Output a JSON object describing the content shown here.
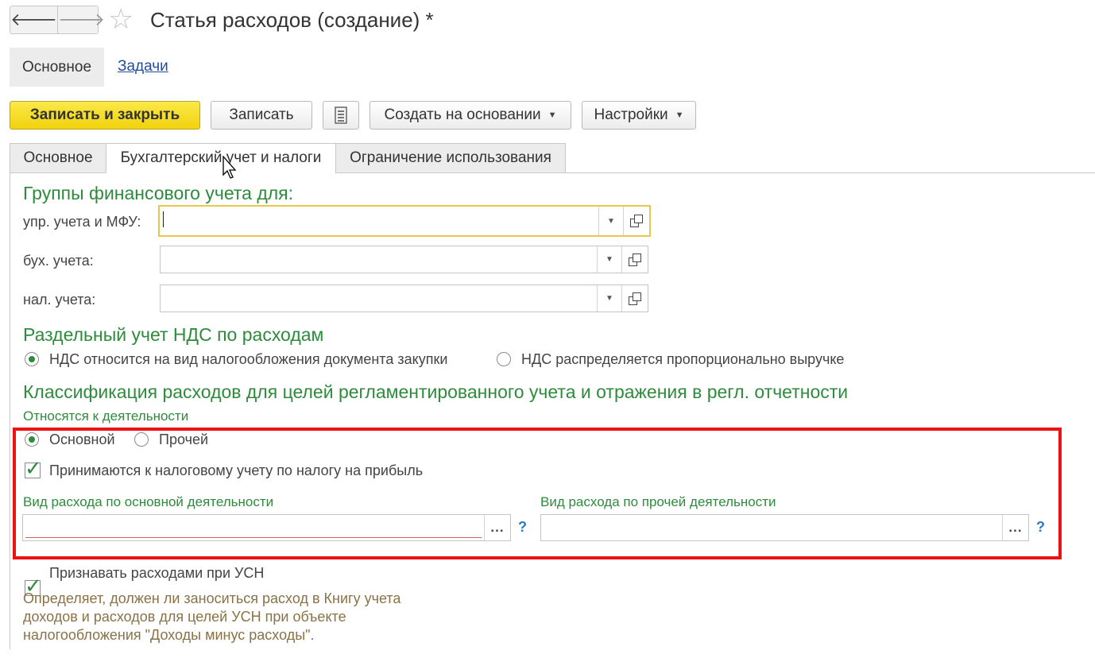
{
  "window": {
    "back_icon": "arrow-left-icon",
    "forward_icon": "arrow-right-icon",
    "favorite_icon": "star-icon",
    "title": "Статья расходов (создание) *"
  },
  "nav": {
    "main": "Основное",
    "tasks": "Задачи"
  },
  "toolbar": {
    "save_close": "Записать и закрыть",
    "save": "Записать",
    "list_icon": "document-list-icon",
    "create_based": "Создать на основании",
    "settings": "Настройки"
  },
  "tabs": [
    {
      "label": "Основное",
      "active": false
    },
    {
      "label": "Бухгалтерский учет и налоги",
      "active": true
    },
    {
      "label": "Ограничение использования",
      "active": false
    }
  ],
  "fin_groups": {
    "header": "Группы финансового учета для:",
    "mgmt_label": "упр. учета и МФУ:",
    "mgmt_value": "",
    "acc_label": "бух. учета:",
    "acc_value": "",
    "tax_label": "нал. учета:",
    "tax_value": ""
  },
  "vat": {
    "header": "Раздельный учет НДС по расходам",
    "option1": "НДС относится на вид налогообложения документа закупки",
    "option2": "НДС распределяется пропорционально выручке",
    "selected": "option1"
  },
  "classification": {
    "header": "Классификация расходов для целей регламентированного учета и отражения в регл. отчетности",
    "activity_label": "Относятся к деятельности",
    "opt_main": "Основной",
    "opt_other": "Прочей",
    "selected": "main",
    "profit_tax_label": "Принимаются к налоговому учету по налогу на прибыль",
    "profit_tax_checked": true,
    "main_expense_label": "Вид расхода по основной деятельности",
    "main_expense_value": "",
    "other_expense_label": "Вид расхода по прочей деятельности",
    "other_expense_value": "",
    "select_button": "...",
    "help": "?"
  },
  "usn": {
    "label": "Признавать расходами при УСН",
    "checked": true,
    "note_line1": "Определяет, должен ли заноситься расход в Книгу учета",
    "note_line2": "доходов и расходов для целей УСН при объекте",
    "note_line3": "налогообложения \"Доходы минус расходы\"."
  },
  "colors": {
    "accent_green": "#2e8b3c",
    "primary_yellow": "#f1d20d",
    "highlight_red": "#ee1111",
    "link_blue": "#1f4e9c"
  }
}
